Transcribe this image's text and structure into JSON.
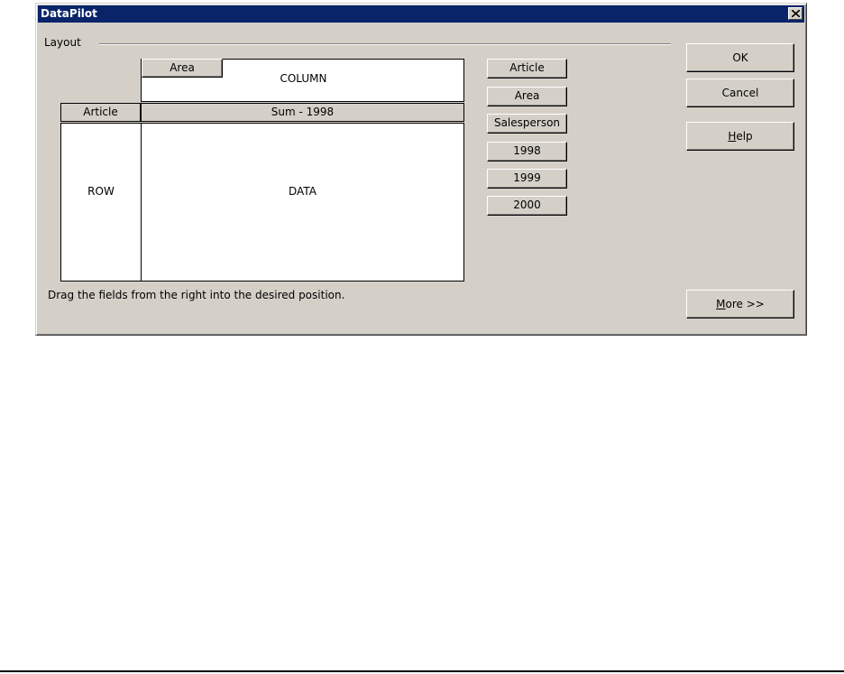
{
  "dialog": {
    "title": "DataPilot",
    "close_glyph": "✕"
  },
  "layout": {
    "label": "Layout",
    "column_zone_label": "COLUMN",
    "row_zone_label": "ROW",
    "data_zone_label": "DATA",
    "column_field": "Area",
    "row_field": "Article",
    "data_field": "Sum - 1998",
    "hint": "Drag the fields from the right into the desired position."
  },
  "fields": [
    "Article",
    "Area",
    "Salesperson",
    "1998",
    "1999",
    "2000"
  ],
  "buttons": {
    "ok": "OK",
    "cancel": "Cancel",
    "help_underlined": "H",
    "help_rest": "elp",
    "more_underlined": "M",
    "more_rest": "ore >>"
  }
}
